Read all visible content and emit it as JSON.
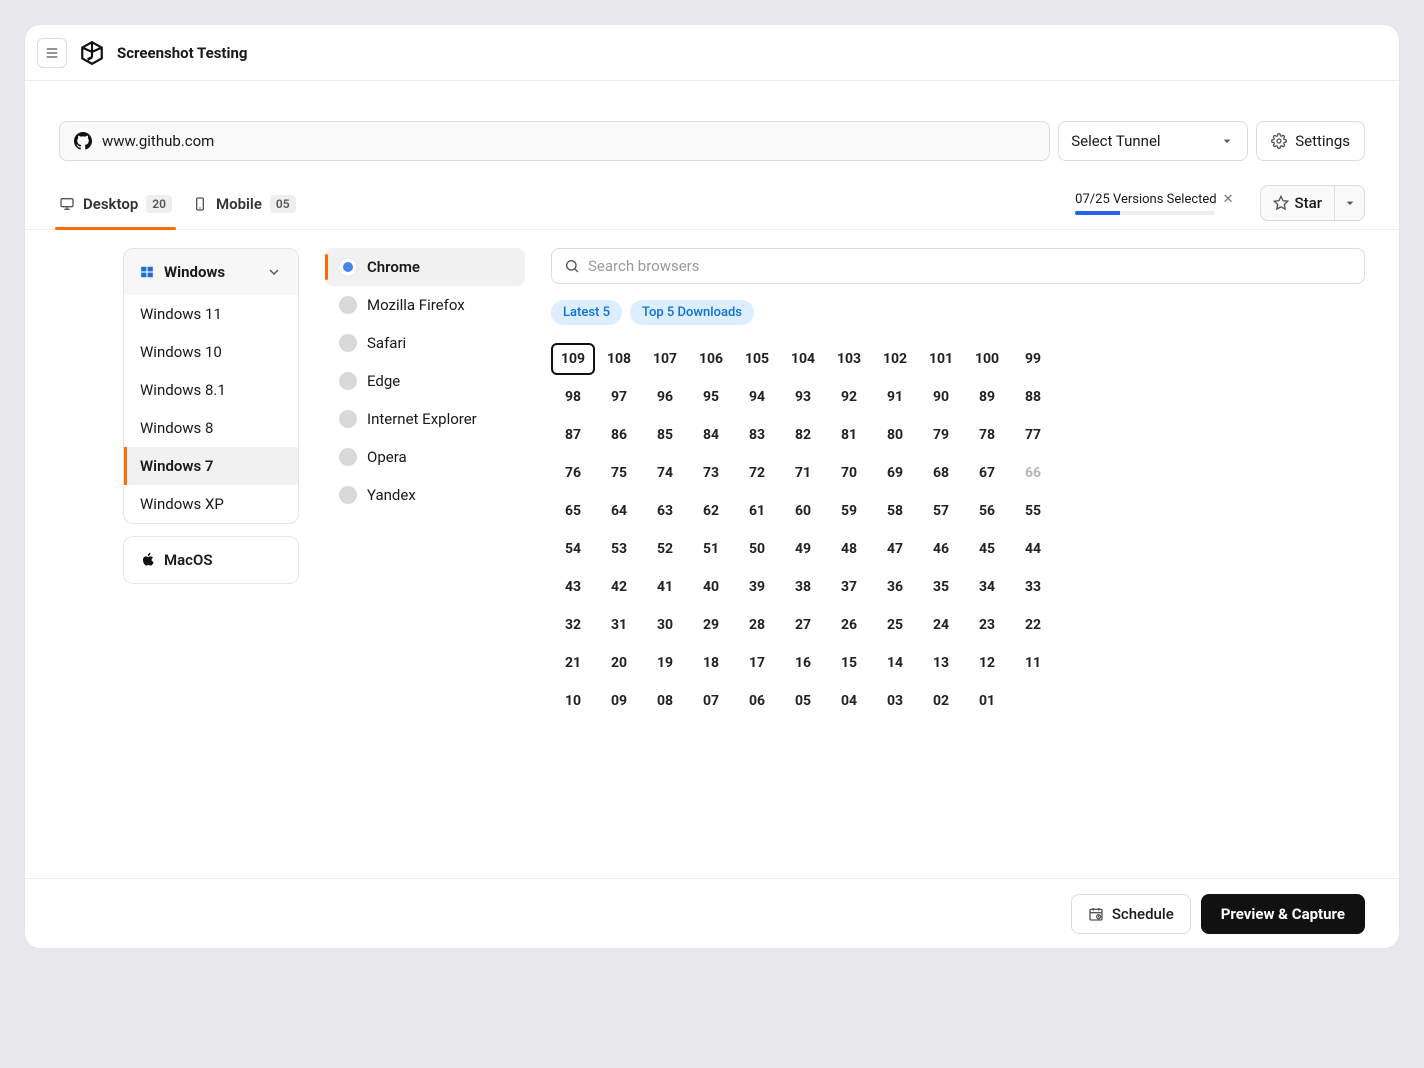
{
  "header": {
    "title": "Screenshot Testing"
  },
  "url_row": {
    "url": "www.github.com",
    "tunnel_placeholder": "Select Tunnel",
    "settings_label": "Settings"
  },
  "tabs": {
    "desktop": {
      "label": "Desktop",
      "count": "20"
    },
    "mobile": {
      "label": "Mobile",
      "count": "05"
    }
  },
  "version_summary": {
    "text": "07/25 Versions Selected",
    "progress_percent": 32
  },
  "star_label": "Star",
  "os": {
    "windows_label": "Windows",
    "macos_label": "MacOS",
    "items": [
      "Windows 11",
      "Windows 10",
      "Windows 8.1",
      "Windows 8",
      "Windows 7",
      "Windows XP"
    ],
    "active_index": 4
  },
  "browsers": {
    "items": [
      "Chrome",
      "Mozilla Firefox",
      "Safari",
      "Edge",
      "Internet Explorer",
      "Opera",
      "Yandex"
    ],
    "active_index": 0
  },
  "search_placeholder": "Search browsers",
  "chips": [
    "Latest 5",
    "Top 5 Downloads"
  ],
  "versions": [
    "109",
    "108",
    "107",
    "106",
    "105",
    "104",
    "103",
    "102",
    "101",
    "100",
    "99",
    "98",
    "97",
    "96",
    "95",
    "94",
    "93",
    "92",
    "91",
    "90",
    "89",
    "88",
    "87",
    "86",
    "85",
    "84",
    "83",
    "82",
    "81",
    "80",
    "79",
    "78",
    "77",
    "76",
    "75",
    "74",
    "73",
    "72",
    "71",
    "70",
    "69",
    "68",
    "67",
    "66",
    "65",
    "64",
    "63",
    "62",
    "61",
    "60",
    "59",
    "58",
    "57",
    "56",
    "55",
    "54",
    "53",
    "52",
    "51",
    "50",
    "49",
    "48",
    "47",
    "46",
    "45",
    "44",
    "43",
    "42",
    "41",
    "40",
    "39",
    "38",
    "37",
    "36",
    "35",
    "34",
    "33",
    "32",
    "31",
    "30",
    "29",
    "28",
    "27",
    "26",
    "25",
    "24",
    "23",
    "22",
    "21",
    "20",
    "19",
    "18",
    "17",
    "16",
    "15",
    "14",
    "13",
    "12",
    "11",
    "10",
    "09",
    "08",
    "07",
    "06",
    "05",
    "04",
    "03",
    "02",
    "01"
  ],
  "selected_versions": [
    "109"
  ],
  "disabled_versions": [
    "66"
  ],
  "footer": {
    "schedule_label": "Schedule",
    "capture_label": "Preview & Capture"
  }
}
